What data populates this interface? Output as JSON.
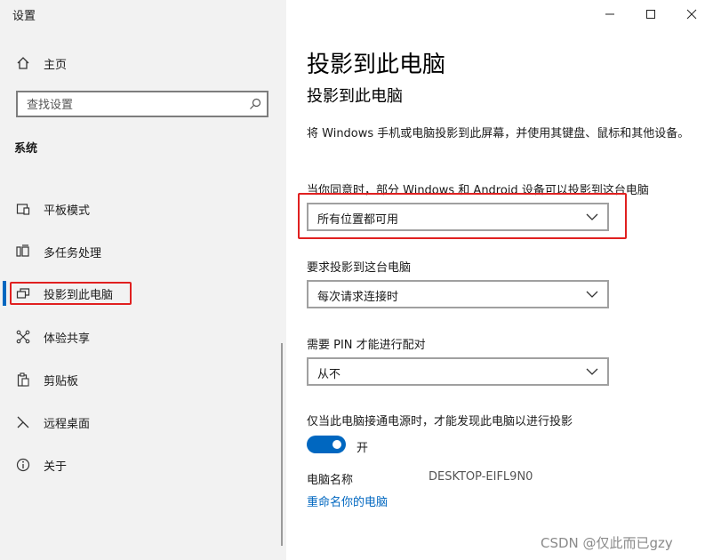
{
  "window": {
    "app_title": "设置",
    "controls": {
      "minimize": "minimize-icon",
      "maximize": "maximize-icon",
      "close": "close-icon"
    }
  },
  "sidebar": {
    "home_label": "主页",
    "search_placeholder": "查找设置",
    "section_title": "系统",
    "items": [
      {
        "label": "平板模式",
        "icon": "tablet-mode-icon"
      },
      {
        "label": "多任务处理",
        "icon": "multitasking-icon"
      },
      {
        "label": "投影到此电脑",
        "icon": "project-to-pc-icon",
        "selected": true
      },
      {
        "label": "体验共享",
        "icon": "shared-experiences-icon"
      },
      {
        "label": "剪贴板",
        "icon": "clipboard-icon"
      },
      {
        "label": "远程桌面",
        "icon": "remote-desktop-icon"
      },
      {
        "label": "关于",
        "icon": "info-icon"
      }
    ]
  },
  "main": {
    "title": "投影到此电脑",
    "subtitle": "投影到此电脑",
    "description": "将 Windows 手机或电脑投影到此屏幕，并使用其键盘、鼠标和其他设备。",
    "availability": {
      "label": "当你同意时，部分 Windows 和 Android 设备可以投影到这台电脑",
      "value": "所有位置都可用"
    },
    "ask_to_project": {
      "label": "要求投影到这台电脑",
      "value": "每次请求连接时"
    },
    "require_pin": {
      "label": "需要 PIN 才能进行配对",
      "value": "从不"
    },
    "power_only": {
      "label": "仅当此电脑接通电源时，才能发现此电脑以进行投影",
      "toggle_state": "开",
      "on": true
    },
    "pc_name": {
      "label": "电脑名称",
      "value": "DESKTOP-EIFL9N0"
    },
    "rename_link": "重命名你的电脑"
  },
  "watermark": "CSDN @仅此而已gzy",
  "colors": {
    "accent": "#0067c0",
    "highlight_box": "#e02020",
    "sidebar_bg": "#f2f2f2"
  }
}
